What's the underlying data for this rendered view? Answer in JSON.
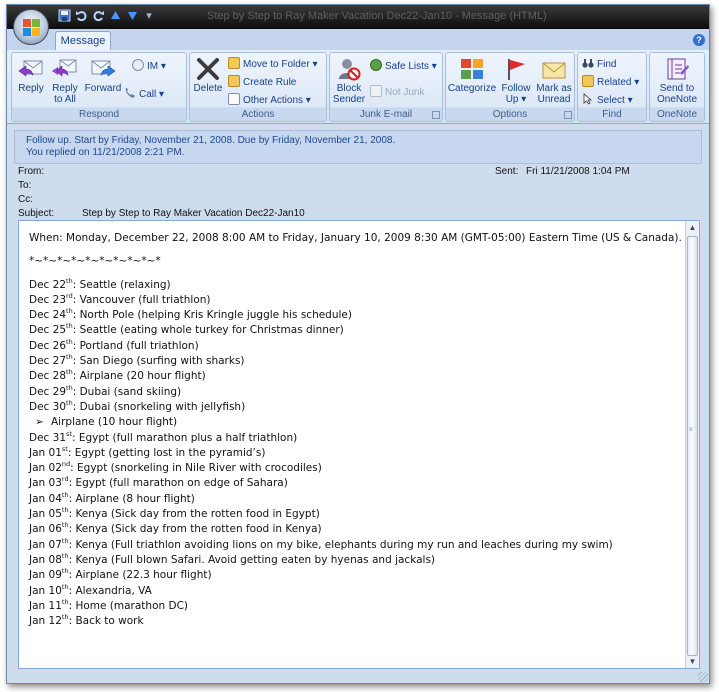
{
  "window": {
    "title": "Step by Step to Ray Maker Vacation Dec22-Jan10 - Message (HTML)",
    "quick_access": [
      "save-icon",
      "undo-icon",
      "redo-icon",
      "up-icon",
      "down-icon",
      "customize-icon"
    ]
  },
  "tabs": [
    {
      "label": "Message",
      "active": true
    }
  ],
  "ribbon": {
    "respond": {
      "label": "Respond",
      "reply": "Reply",
      "reply_all_line1": "Reply",
      "reply_all_line2": "to All",
      "forward": "Forward",
      "im": "IM",
      "call": "Call"
    },
    "actions": {
      "label": "Actions",
      "delete": "Delete",
      "move_to_folder": "Move to Folder",
      "create_rule": "Create Rule",
      "other_actions": "Other Actions"
    },
    "junk": {
      "label": "Junk E-mail",
      "block_line1": "Block",
      "block_line2": "Sender",
      "safe_lists": "Safe Lists",
      "not_junk": "Not Junk"
    },
    "options": {
      "label": "Options",
      "categorize": "Categorize",
      "follow_line1": "Follow",
      "follow_line2": "Up",
      "mark_line1": "Mark as",
      "mark_line2": "Unread"
    },
    "find": {
      "label": "Find",
      "find": "Find",
      "related": "Related",
      "select": "Select"
    },
    "onenote": {
      "label": "OneNote",
      "send_line1": "Send to",
      "send_line2": "OneNote"
    }
  },
  "infobar": {
    "line1": "Follow up.  Start by Friday, November 21, 2008.  Due by Friday, November 21, 2008.",
    "line2": "You replied on 11/21/2008 2:21 PM."
  },
  "header": {
    "from_label": "From:",
    "from_value": "",
    "to_label": "To:",
    "cc_label": "Cc:",
    "subject_label": "Subject:",
    "subject_value": "Step by Step to Ray Maker Vacation Dec22-Jan10",
    "sent_label": "Sent:",
    "sent_value": "Fri 11/21/2008 1:04 PM"
  },
  "body": {
    "when": "When: Monday, December 22, 2008 8:00 AM to Friday, January 10, 2009 8:30 AM (GMT-05:00) Eastern Time (US & Canada).",
    "separator": "*~*~*~*~*~*~*~*~*~*",
    "items": [
      {
        "date": "Dec 22",
        "sup": "th",
        "text": ": Seattle (relaxing)"
      },
      {
        "date": "Dec 23",
        "sup": "rd",
        "text": ": Vancouver (full triathlon)"
      },
      {
        "date": "Dec 24",
        "sup": "th",
        "text": ": North Pole (helping Kris Kringle juggle his schedule)"
      },
      {
        "date": "Dec 25",
        "sup": "th",
        "text": ": Seattle (eating whole turkey for Christmas dinner)"
      },
      {
        "date": "Dec 26",
        "sup": "th",
        "text": ": Portland (full triathlon)"
      },
      {
        "date": "Dec 27",
        "sup": "th",
        "text": ": San Diego (surfing with sharks)"
      },
      {
        "date": "Dec 28",
        "sup": "th",
        "text": ": Airplane (20 hour flight)"
      },
      {
        "date": "Dec 29",
        "sup": "th",
        "text": ": Dubai (sand skiing)"
      },
      {
        "date": "Dec 30",
        "sup": "th",
        "text": ": Dubai (snorkeling with jellyfish)"
      },
      {
        "date": "",
        "sup": "",
        "text": "Airplane (10 hour flight)",
        "bullet": "➢"
      },
      {
        "date": "Dec 31",
        "sup": "st",
        "text": ": Egypt (full marathon plus a half triathlon)"
      },
      {
        "date": "Jan 01",
        "sup": "st",
        "text": ":  Egypt (getting lost in the pyramid’s)"
      },
      {
        "date": "Jan 02",
        "sup": "nd",
        "text": ": Egypt (snorkeling in Nile River with crocodiles)"
      },
      {
        "date": "Jan 03",
        "sup": "rd",
        "text": ": Egypt (full marathon on edge of Sahara)"
      },
      {
        "date": "Jan 04",
        "sup": "th",
        "text": ": Airplane (8 hour flight)"
      },
      {
        "date": "Jan 05",
        "sup": "th",
        "text": ": Kenya (Sick day from the rotten food in Egypt)"
      },
      {
        "date": "Jan 06",
        "sup": "th",
        "text": ": Kenya (Sick day from the rotten food in Kenya)"
      },
      {
        "date": "Jan 07",
        "sup": "th",
        "text": ": Kenya (Full triathlon avoiding lions on my bike, elephants during my run and leaches during my swim)"
      },
      {
        "date": "Jan 08",
        "sup": "th",
        "text": ": Kenya (Full blown Safari. Avoid getting eaten by hyenas and jackals)"
      },
      {
        "date": "Jan 09",
        "sup": "th",
        "text": ": Airplane (22.3 hour flight)"
      },
      {
        "date": "Jan 10",
        "sup": "th",
        "text": ": Alexandria, VA"
      },
      {
        "date": "Jan 11",
        "sup": "th",
        "text": ": Home (marathon DC)"
      },
      {
        "date": "Jan 12",
        "sup": "th",
        "text": ": Back to work"
      }
    ]
  },
  "colors": {
    "accent": "#15428b",
    "ribbon_bg": "#dde8f6",
    "titlebar": "#111111"
  }
}
